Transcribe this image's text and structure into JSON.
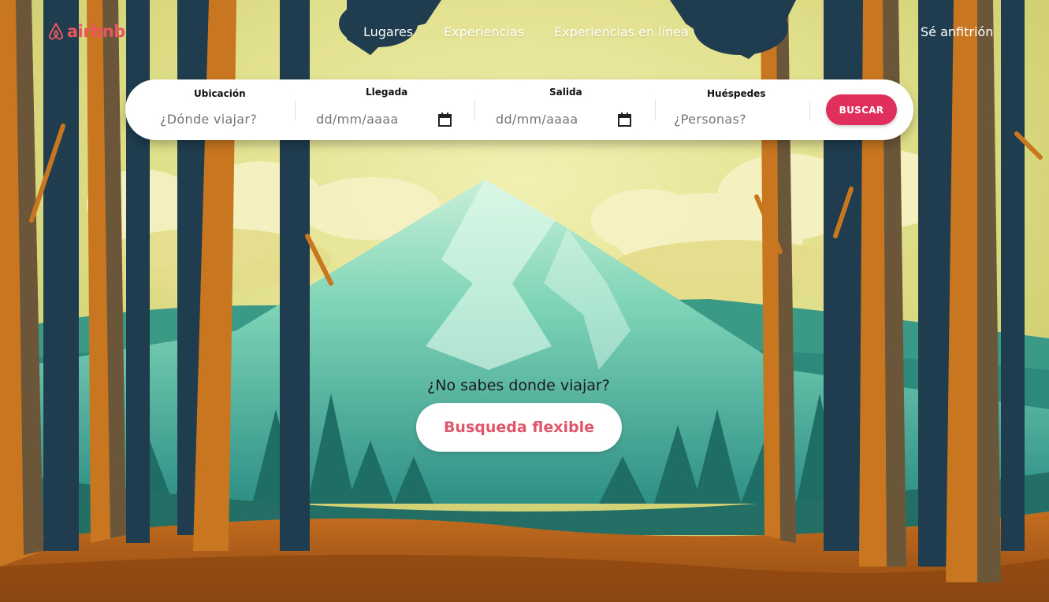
{
  "brand": {
    "name": "airbnb",
    "color": "#e8565f"
  },
  "nav": {
    "links": [
      "Lugares",
      "Experiencias",
      "Experiencias en línea"
    ],
    "host_link": "Sé anfitrión"
  },
  "search": {
    "location": {
      "label": "Ubicación",
      "placeholder": "¿Dónde viajar?"
    },
    "checkin": {
      "label": "Llegada",
      "value": "dd/mm/aaaa",
      "icon": "calendar-icon"
    },
    "checkout": {
      "label": "Salida",
      "value": "dd/mm/aaaa",
      "icon": "calendar-icon"
    },
    "guests": {
      "label": "Huéspedes",
      "placeholder": "¿Personas?"
    },
    "button": "BUSCAR",
    "button_color": "#df2f5a"
  },
  "hero": {
    "question": "¿No sabes donde viajar?",
    "cta": "Busqueda flexible",
    "cta_color": "#e0566a",
    "background": "forest-mountain-illustration"
  }
}
